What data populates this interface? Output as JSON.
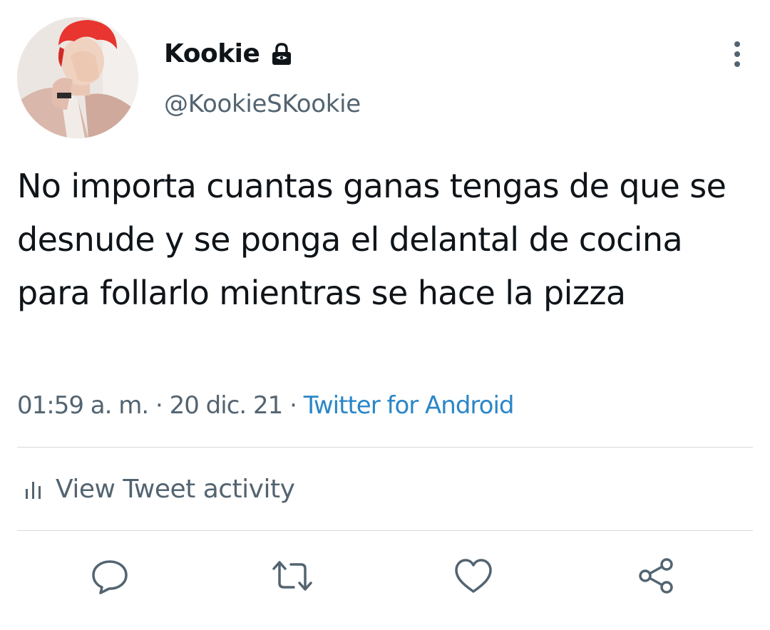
{
  "tweet": {
    "author": {
      "display_name": "Kookie",
      "handle": "@KookieSKookie",
      "protected_icon": "lock-icon",
      "avatar": "avatar"
    },
    "text": "No importa cuantas ganas tengas de que se desnude y se ponga el delantal de cocina para follarlo mientras se hace la pizza",
    "time": "01:59 a. m.",
    "date": "20 dic. 21",
    "separator": "·",
    "source": "Twitter for Android"
  },
  "activity": {
    "label": "View Tweet activity",
    "icon": "bar-chart-icon"
  },
  "actions": [
    {
      "name": "reply",
      "icon": "reply-icon"
    },
    {
      "name": "retweet",
      "icon": "retweet-icon"
    },
    {
      "name": "like",
      "icon": "heart-icon"
    },
    {
      "name": "share",
      "icon": "share-icon"
    }
  ],
  "colors": {
    "text": "#0f1419",
    "secondary": "#536471",
    "link": "#2a86c8",
    "divider": "#d6dade"
  }
}
